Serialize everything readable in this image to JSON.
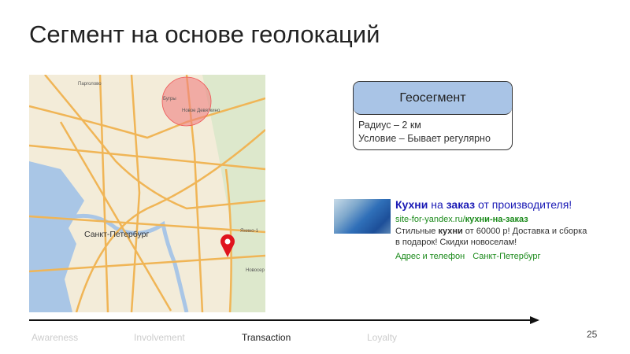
{
  "slide": {
    "title": "Сегмент на основе геолокаций",
    "page_number": "25"
  },
  "map": {
    "labels": {
      "pargolovo": "Парголово",
      "bugry": "Бугры",
      "devyatkino": "Новое Девяткино",
      "city": "Санкт-Петербург",
      "yanino": "Янино-1",
      "novoser": "Новосер"
    },
    "circle_color": "#f08080",
    "pin_color": "#e0141e"
  },
  "geosegment": {
    "header": "Геосегмент",
    "radius": "Радиус – 2 км",
    "condition": "Условие – Бывает регулярно",
    "header_color": "#a9c4e6"
  },
  "ad": {
    "title_part1": "Кухни",
    "title_part2": " на ",
    "title_part3": "заказ",
    "title_part4": " от производителя!",
    "url_plain": "site-for-yandex.ru/",
    "url_bold": "кухни-на-заказ",
    "text_part1": "Стильные ",
    "text_bold": "кухни",
    "text_part2": " от 60000 р! Доставка и сборка в подарок! Скидки новоселам!",
    "link1": "Адрес и телефон",
    "link2": "Санкт-Петербург"
  },
  "timeline": {
    "stages": [
      "Awareness",
      "Involvement",
      "Transaction",
      "Loyalty"
    ],
    "active": "Transaction"
  }
}
